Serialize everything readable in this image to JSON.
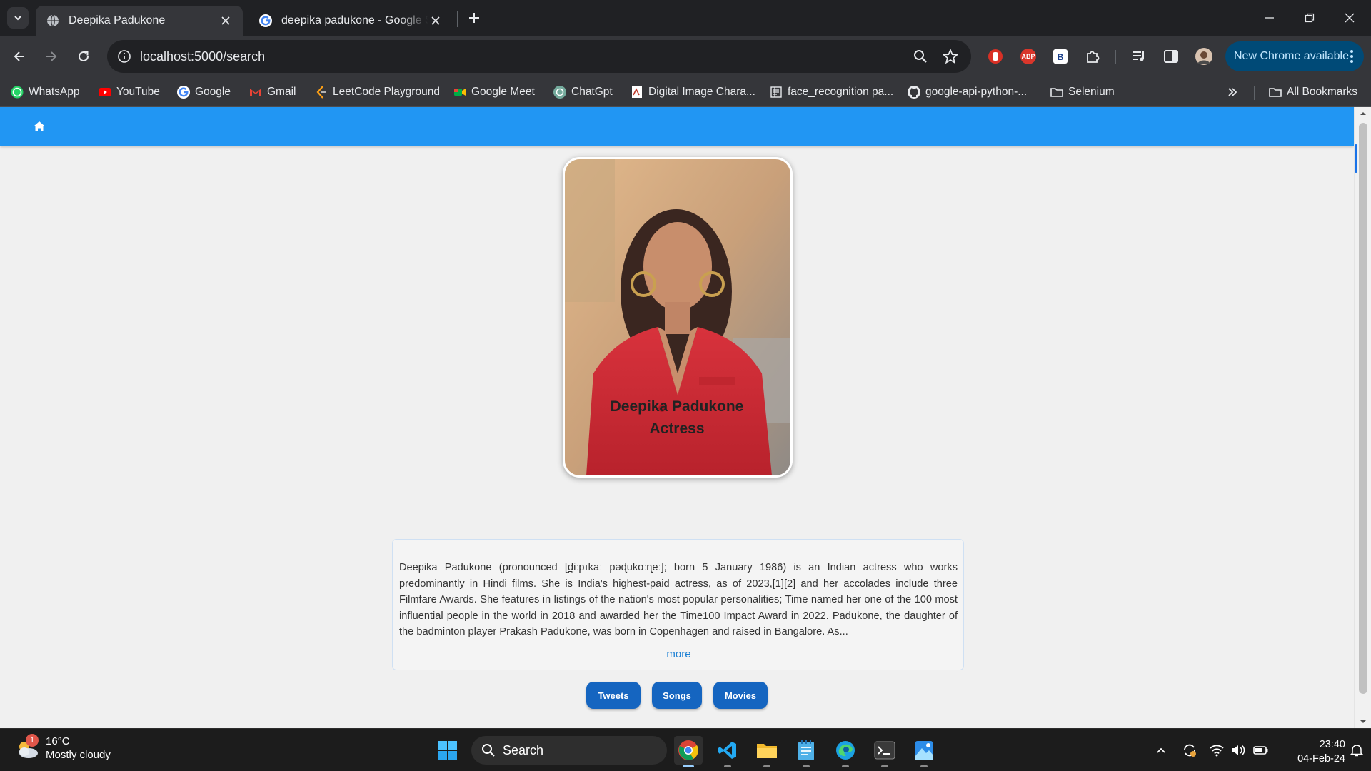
{
  "browser": {
    "tabs": [
      {
        "title": "Deepika Padukone",
        "active": true,
        "favicon": "globe-icon"
      },
      {
        "title": "deepika padukone - Google Search",
        "active": false,
        "favicon": "google-icon"
      }
    ],
    "address": "localhost:5000/search",
    "update_button": "New Chrome available",
    "bookmarks": [
      {
        "label": "WhatsApp",
        "icon": "whatsapp-icon"
      },
      {
        "label": "YouTube",
        "icon": "youtube-icon"
      },
      {
        "label": "Google",
        "icon": "google-icon"
      },
      {
        "label": "Gmail",
        "icon": "gmail-icon"
      },
      {
        "label": "LeetCode Playground",
        "icon": "leetcode-icon"
      },
      {
        "label": "Google Meet",
        "icon": "meet-icon"
      },
      {
        "label": "ChatGpt",
        "icon": "chatgpt-icon"
      },
      {
        "label": "Digital Image Chara...",
        "icon": "page-icon"
      },
      {
        "label": "face_recognition pa...",
        "icon": "page-icon"
      },
      {
        "label": "google-api-python-...",
        "icon": "github-icon"
      },
      {
        "label": "Selenium",
        "icon": "folder-icon"
      }
    ],
    "all_bookmarks": "All Bookmarks"
  },
  "page": {
    "name": "Deepika Padukone",
    "profession": "Actress",
    "bio": "Deepika Padukone (pronounced [d̪iːpɪkaː pəɖukoːɳeː]; born 5 January 1986) is an Indian actress who works predominantly in Hindi films. She is India's highest-paid actress, as of 2023,[1][2] and her accolades include three Filmfare Awards. She features in listings of the nation's most popular personalities; Time named her one of the 100 most influential people in the world in 2018 and awarded her the Time100 Impact Award in 2022. Padukone, the daughter of the badminton player Prakash Padukone, was born in Copenhagen and raised in Bangalore. As...",
    "more_label": "more",
    "buttons": [
      "Tweets",
      "Songs",
      "Movies"
    ]
  },
  "taskbar": {
    "weather_temp": "16°C",
    "weather_desc": "Mostly cloudy",
    "weather_badge": "1",
    "search_label": "Search",
    "time": "23:40",
    "date": "04-Feb-24"
  },
  "colors": {
    "app_nav": "#2196f3",
    "button": "#1565c0",
    "link": "#1a7fd4",
    "update_pill": "#004a77"
  }
}
